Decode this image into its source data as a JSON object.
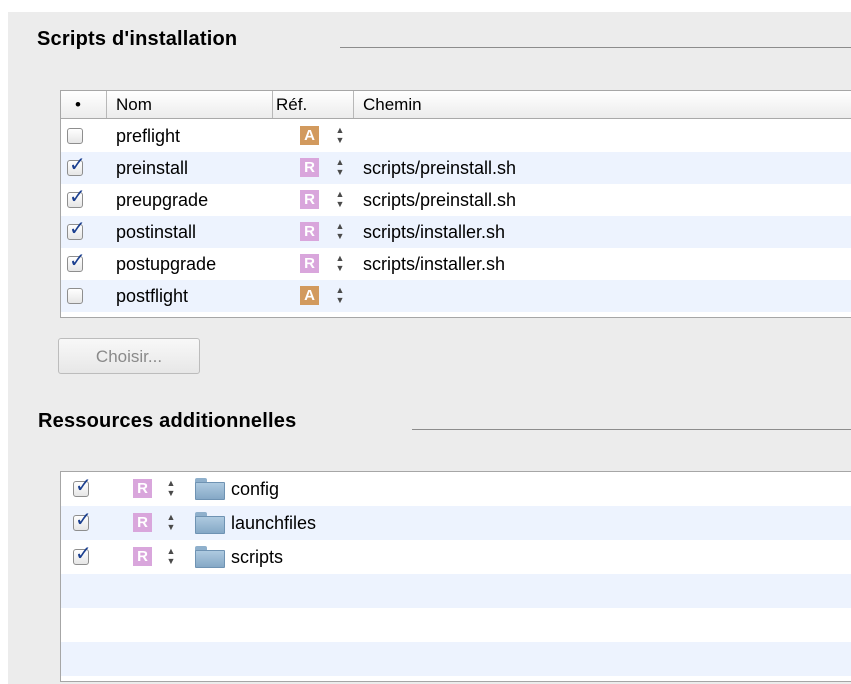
{
  "sections": {
    "scripts_title": "Scripts d'installation",
    "resources_title": "Ressources additionnelles"
  },
  "scripts_table": {
    "columns": [
      "•",
      "Nom",
      "Réf.",
      "Chemin"
    ],
    "rows": [
      {
        "checked": false,
        "name": "preflight",
        "ref": "A",
        "path": ""
      },
      {
        "checked": true,
        "name": "preinstall",
        "ref": "R",
        "path": "scripts/preinstall.sh"
      },
      {
        "checked": true,
        "name": "preupgrade",
        "ref": "R",
        "path": "scripts/preinstall.sh"
      },
      {
        "checked": true,
        "name": "postinstall",
        "ref": "R",
        "path": "scripts/installer.sh"
      },
      {
        "checked": true,
        "name": "postupgrade",
        "ref": "R",
        "path": "scripts/installer.sh"
      },
      {
        "checked": false,
        "name": "postflight",
        "ref": "A",
        "path": ""
      }
    ]
  },
  "choose_button": "Choisir...",
  "resources_table": {
    "rows": [
      {
        "checked": true,
        "ref": "R",
        "icon": "folder-icon",
        "name": "config"
      },
      {
        "checked": true,
        "ref": "R",
        "icon": "folder-icon",
        "name": "launchfiles"
      },
      {
        "checked": true,
        "ref": "R",
        "icon": "folder-icon",
        "name": "scripts"
      }
    ]
  },
  "colors": {
    "ref_R": "#d9a6dc",
    "ref_A": "#d29a5e",
    "row_alt": "#edf3fe",
    "check": "#1b3f8f"
  }
}
